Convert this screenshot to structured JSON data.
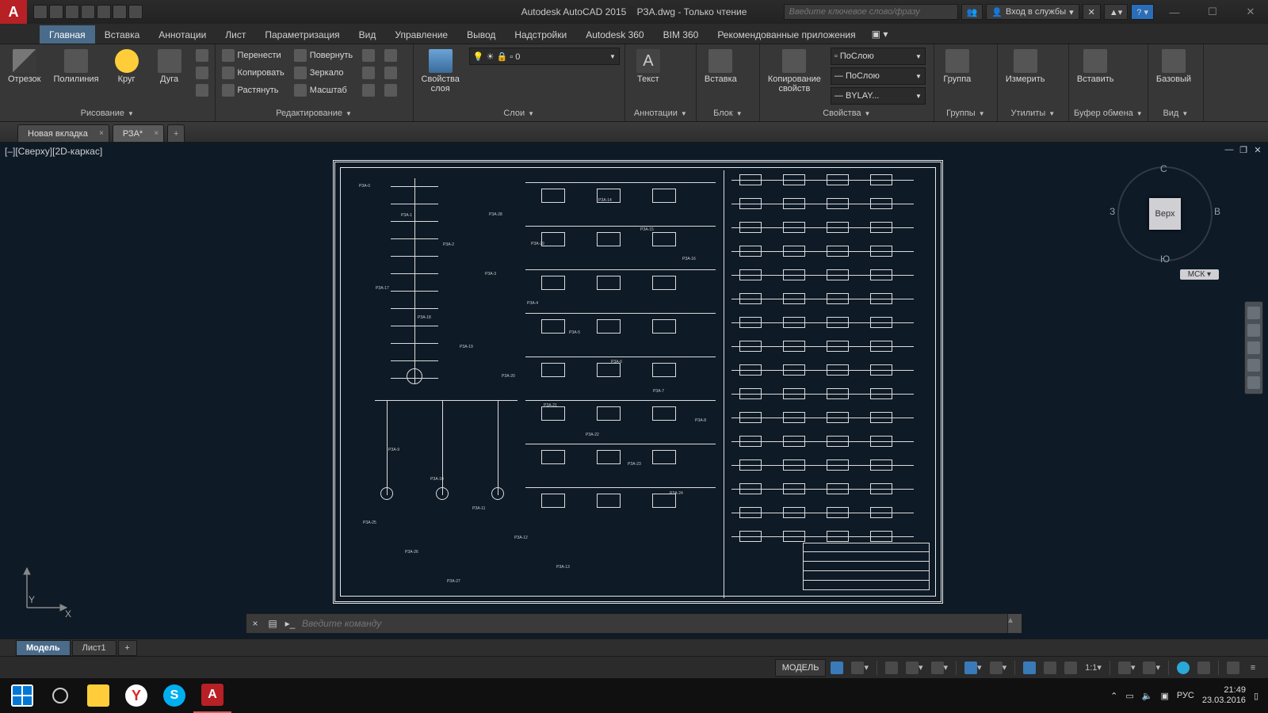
{
  "title": {
    "app": "Autodesk AutoCAD 2015",
    "file": "РЗА.dwg - Только чтение"
  },
  "search": {
    "placeholder": "Введите ключевое слово/фразу"
  },
  "signin_label": "Вход в службы",
  "ribbon_tabs": [
    "Главная",
    "Вставка",
    "Аннотации",
    "Лист",
    "Параметризация",
    "Вид",
    "Управление",
    "Вывод",
    "Надстройки",
    "Autodesk 360",
    "BIM 360",
    "Рекомендованные приложения"
  ],
  "ribbon_active": 0,
  "panels": {
    "draw": {
      "title": "Рисование",
      "items": [
        "Отрезок",
        "Полилиния",
        "Круг",
        "Дуга"
      ]
    },
    "modify": {
      "title": "Редактирование",
      "items": [
        "Перенести",
        "Повернуть",
        "Копировать",
        "Зеркало",
        "Растянуть",
        "Масштаб"
      ]
    },
    "layerprops": {
      "title": "Свойства слоя",
      "big": "Свойства\nслоя",
      "current": "0"
    },
    "layers": {
      "title": "Слои"
    },
    "annot": {
      "title": "Аннотации",
      "big": "Текст"
    },
    "block": {
      "title": "Блок",
      "big": "Вставка"
    },
    "props": {
      "title": "Свойства",
      "big": "Копирование\nсвойств",
      "d1": "ПоСлою",
      "d2": "ПоСлою",
      "d3": "BYLAY..."
    },
    "groups": {
      "title": "Группы",
      "big": "Группа"
    },
    "util": {
      "title": "Утилиты",
      "big": "Измерить"
    },
    "clip": {
      "title": "Буфер обмена",
      "big": "Вставить"
    },
    "view": {
      "title": "Вид",
      "big": "Базовый"
    }
  },
  "filetabs": [
    {
      "label": "Новая вкладка",
      "active": false
    },
    {
      "label": "РЗА*",
      "active": true
    }
  ],
  "view_label": "[–][Сверху][2D-каркас]",
  "viewcube": {
    "top": "С",
    "bottom": "Ю",
    "left": "З",
    "right": "В",
    "face": "Верх",
    "msk": "МСК"
  },
  "cmd": {
    "placeholder": "Введите команду"
  },
  "layout_tabs": [
    {
      "label": "Модель",
      "active": true
    },
    {
      "label": "Лист1",
      "active": false
    }
  ],
  "status": {
    "model": "МОДЕЛЬ",
    "scale": "1:1"
  },
  "ucs": {
    "x": "X",
    "y": "Y"
  },
  "taskbar": {
    "lang": "РУС",
    "time": "21:49",
    "date": "23.03.2016"
  }
}
